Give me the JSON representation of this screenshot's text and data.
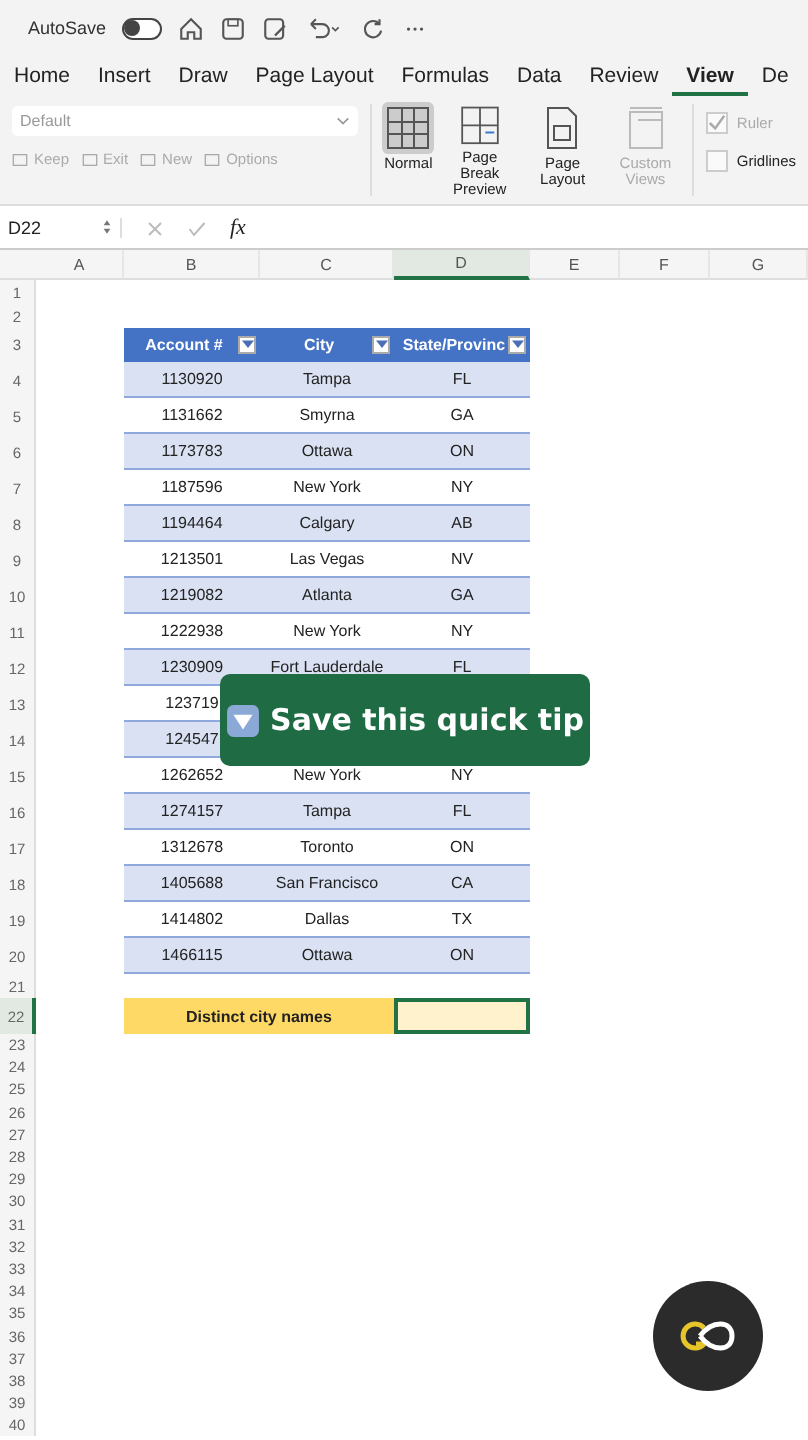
{
  "quick_access": {
    "autosave_label": "AutoSave",
    "autosave_on": false
  },
  "tabs": [
    {
      "label": "Home",
      "selected": false
    },
    {
      "label": "Insert",
      "selected": false
    },
    {
      "label": "Draw",
      "selected": false
    },
    {
      "label": "Page Layout",
      "selected": false
    },
    {
      "label": "Formulas",
      "selected": false
    },
    {
      "label": "Data",
      "selected": false
    },
    {
      "label": "Review",
      "selected": false
    },
    {
      "label": "View",
      "selected": true
    },
    {
      "label": "De",
      "selected": false
    }
  ],
  "ribbon": {
    "sheet_view": {
      "value": "Default"
    },
    "sheet_view_buttons": [
      {
        "label": "Keep",
        "disabled": true
      },
      {
        "label": "Exit",
        "disabled": true
      },
      {
        "label": "New",
        "disabled": true
      },
      {
        "label": "Options",
        "disabled": true
      }
    ],
    "workbook_views": [
      {
        "label": "Normal",
        "kind": "normal",
        "selected": true,
        "disabled": false
      },
      {
        "label": "Page Break Preview",
        "kind": "pagebreak",
        "selected": false,
        "disabled": false
      },
      {
        "label": "Page Layout",
        "kind": "layout",
        "selected": false,
        "disabled": false
      },
      {
        "label": "Custom Views",
        "kind": "custom",
        "selected": false,
        "disabled": true
      }
    ],
    "show": [
      {
        "label": "Ruler",
        "checked": true,
        "disabled": true
      },
      {
        "label": "Gridlines",
        "checked": false,
        "disabled": false
      }
    ]
  },
  "formula_bar": {
    "name_box": "D22",
    "fx": "fx"
  },
  "sheet": {
    "columns": [
      {
        "label": "A",
        "selected": false
      },
      {
        "label": "B",
        "selected": false
      },
      {
        "label": "C",
        "selected": false
      },
      {
        "label": "D",
        "selected": true
      },
      {
        "label": "E",
        "selected": false
      },
      {
        "label": "F",
        "selected": false
      },
      {
        "label": "G",
        "selected": false
      }
    ],
    "rows": [
      {
        "number": "1",
        "selected": false
      },
      {
        "number": "2",
        "selected": false
      },
      {
        "number": "3",
        "selected": false
      },
      {
        "number": "4",
        "selected": false
      },
      {
        "number": "5",
        "selected": false
      },
      {
        "number": "6",
        "selected": false
      },
      {
        "number": "7",
        "selected": false
      },
      {
        "number": "8",
        "selected": false
      },
      {
        "number": "9",
        "selected": false
      },
      {
        "number": "10",
        "selected": false
      },
      {
        "number": "11",
        "selected": false
      },
      {
        "number": "12",
        "selected": false
      },
      {
        "number": "13",
        "selected": false
      },
      {
        "number": "14",
        "selected": false
      },
      {
        "number": "15",
        "selected": false
      },
      {
        "number": "16",
        "selected": false
      },
      {
        "number": "17",
        "selected": false
      },
      {
        "number": "18",
        "selected": false
      },
      {
        "number": "19",
        "selected": false
      },
      {
        "number": "20",
        "selected": false
      },
      {
        "number": "21",
        "selected": false
      },
      {
        "number": "22",
        "selected": true
      },
      {
        "number": "23",
        "selected": false
      },
      {
        "number": "24",
        "selected": false
      },
      {
        "number": "25",
        "selected": false
      },
      {
        "number": "26",
        "selected": false
      },
      {
        "number": "27",
        "selected": false
      },
      {
        "number": "28",
        "selected": false
      },
      {
        "number": "29",
        "selected": false
      },
      {
        "number": "30",
        "selected": false
      },
      {
        "number": "31",
        "selected": false
      },
      {
        "number": "32",
        "selected": false
      },
      {
        "number": "33",
        "selected": false
      },
      {
        "number": "34",
        "selected": false
      },
      {
        "number": "35",
        "selected": false
      },
      {
        "number": "36",
        "selected": false
      },
      {
        "number": "37",
        "selected": false
      },
      {
        "number": "38",
        "selected": false
      },
      {
        "number": "39",
        "selected": false
      },
      {
        "number": "40",
        "selected": false
      }
    ]
  },
  "table": {
    "columns": [
      "Account #",
      "City",
      "State/Provinc"
    ],
    "rows": [
      {
        "account": "1130920",
        "city": "Tampa",
        "state": "FL"
      },
      {
        "account": "1131662",
        "city": "Smyrna",
        "state": "GA"
      },
      {
        "account": "1173783",
        "city": "Ottawa",
        "state": "ON"
      },
      {
        "account": "1187596",
        "city": "New York",
        "state": "NY"
      },
      {
        "account": "1194464",
        "city": "Calgary",
        "state": "AB"
      },
      {
        "account": "1213501",
        "city": "Las Vegas",
        "state": "NV"
      },
      {
        "account": "1219082",
        "city": "Atlanta",
        "state": "GA"
      },
      {
        "account": "1222938",
        "city": "New York",
        "state": "NY"
      },
      {
        "account": "1230909",
        "city": "Fort Lauderdale",
        "state": "FL"
      },
      {
        "account": "123719"
      },
      {
        "account": "124547"
      },
      {
        "account": "1262652",
        "city": "New York",
        "state": "NY"
      },
      {
        "account": "1274157",
        "city": "Tampa",
        "state": "FL"
      },
      {
        "account": "1312678",
        "city": "Toronto",
        "state": "ON"
      },
      {
        "account": "1405688",
        "city": "San Francisco",
        "state": "CA"
      },
      {
        "account": "1414802",
        "city": "Dallas",
        "state": "TX"
      },
      {
        "account": "1466115",
        "city": "Ottawa",
        "state": "ON"
      }
    ]
  },
  "summary": {
    "label": "Distinct city names",
    "value_selected": true
  },
  "overlay": {
    "text": "Save this quick tip"
  }
}
